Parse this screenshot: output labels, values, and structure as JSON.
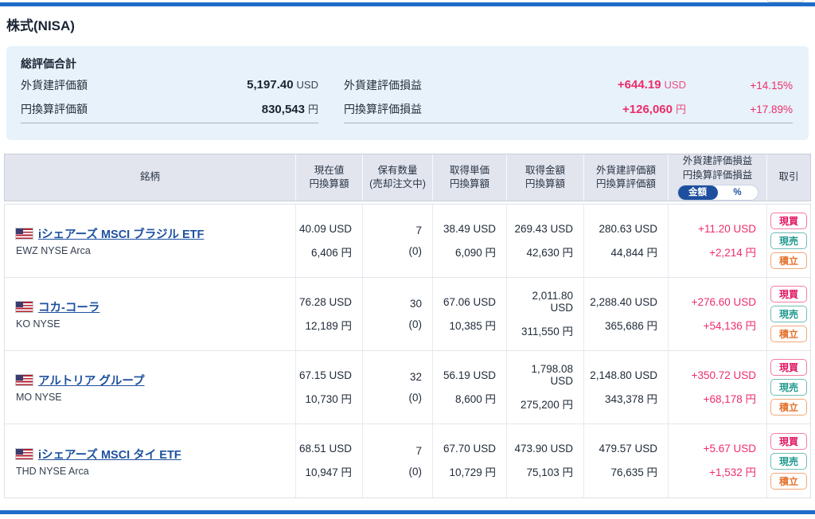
{
  "page": {
    "title": "株式(NISA)"
  },
  "colors": {
    "accent_blue": "#1e6cc7",
    "link_blue": "#1d509f",
    "toggle_blue": "#1d4f9e",
    "gain_pink": "#ed2d6a",
    "buy_red": "#e01562",
    "sell_teal": "#1f998e",
    "accumulate_orange": "#e4732e",
    "summary_bg": "#e7f2fa",
    "table_header_bg": "#e2e5ee"
  },
  "summary": {
    "title": "総評価合計",
    "left": [
      {
        "label": "外貨建評価額",
        "value": "5,197.40",
        "unit": "USD"
      },
      {
        "label": "円換算評価額",
        "value": "830,543",
        "unit": "円"
      }
    ],
    "right": [
      {
        "label": "外貨建評価損益",
        "value": "+644.19",
        "unit": "USD",
        "pct": "+14.15%"
      },
      {
        "label": "円換算評価損益",
        "value": "+126,060",
        "unit": "円",
        "pct": "+17.89%"
      }
    ]
  },
  "table": {
    "columns": {
      "name": "銘柄",
      "price": [
        "現在値",
        "円換算額"
      ],
      "qty": [
        "保有数量",
        "(売却注文中)"
      ],
      "unit_cost": [
        "取得単価",
        "円換算額"
      ],
      "cost": [
        "取得金額",
        "円換算額"
      ],
      "value": [
        "外貨建評価額",
        "円換算評価額"
      ],
      "gain": [
        "外貨建評価損益",
        "円換算評価損益"
      ],
      "trade": "取引"
    },
    "gain_toggle": {
      "amount": "金額",
      "percent": "%"
    },
    "action_labels": [
      "現買",
      "現売",
      "積立"
    ],
    "rows": [
      {
        "name": "iシェアーズ MSCI ブラジル ETF",
        "ticker": "EWZ NYSE Arca",
        "price_usd": "40.09 USD",
        "price_jpy": "6,406 円",
        "qty": "7",
        "qty_pending": "(0)",
        "unit_cost_usd": "38.49 USD",
        "unit_cost_jpy": "6,090 円",
        "cost_usd": "269.43 USD",
        "cost_jpy": "42,630 円",
        "value_usd": "280.63 USD",
        "value_jpy": "44,844 円",
        "gain_usd": "+11.20 USD",
        "gain_jpy": "+2,214 円"
      },
      {
        "name": "コカ-コーラ",
        "ticker": "KO NYSE",
        "price_usd": "76.28 USD",
        "price_jpy": "12,189 円",
        "qty": "30",
        "qty_pending": "(0)",
        "unit_cost_usd": "67.06 USD",
        "unit_cost_jpy": "10,385 円",
        "cost_usd": "2,011.80 USD",
        "cost_jpy": "311,550 円",
        "value_usd": "2,288.40 USD",
        "value_jpy": "365,686 円",
        "gain_usd": "+276.60 USD",
        "gain_jpy": "+54,136 円"
      },
      {
        "name": "アルトリア グループ",
        "ticker": "MO NYSE",
        "price_usd": "67.15 USD",
        "price_jpy": "10,730 円",
        "qty": "32",
        "qty_pending": "(0)",
        "unit_cost_usd": "56.19 USD",
        "unit_cost_jpy": "8,600 円",
        "cost_usd": "1,798.08 USD",
        "cost_jpy": "275,200 円",
        "value_usd": "2,148.80 USD",
        "value_jpy": "343,378 円",
        "gain_usd": "+350.72 USD",
        "gain_jpy": "+68,178 円"
      },
      {
        "name": "iシェアーズ MSCI タイ ETF",
        "ticker": "THD NYSE Arca",
        "price_usd": "68.51 USD",
        "price_jpy": "10,947 円",
        "qty": "7",
        "qty_pending": "(0)",
        "unit_cost_usd": "67.70 USD",
        "unit_cost_jpy": "10,729 円",
        "cost_usd": "473.90 USD",
        "cost_jpy": "75,103 円",
        "value_usd": "479.57 USD",
        "value_jpy": "76,635 円",
        "gain_usd": "+5.67 USD",
        "gain_jpy": "+1,532 円"
      }
    ]
  }
}
